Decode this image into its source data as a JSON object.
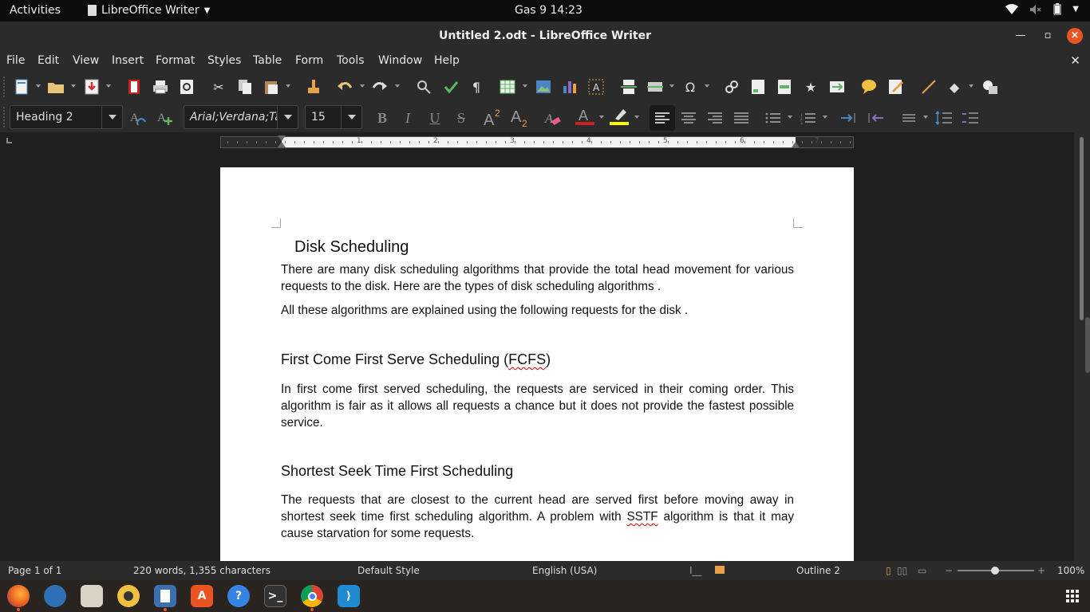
{
  "topbar": {
    "activities": "Activities",
    "app_name": "LibreOffice Writer",
    "clock": "Gas 9  14:23"
  },
  "window": {
    "title": "Untitled 2.odt - LibreOffice Writer"
  },
  "menubar": {
    "items": [
      "File",
      "Edit",
      "View",
      "Insert",
      "Format",
      "Styles",
      "Table",
      "Form",
      "Tools",
      "Window",
      "Help"
    ]
  },
  "formatting": {
    "paragraph_style": "Heading 2",
    "font_name": "Arial;Verdana;Ta",
    "font_size": "15"
  },
  "ruler": {
    "numbers": [
      "1",
      "2",
      "3",
      "4",
      "5",
      "6",
      "7"
    ]
  },
  "document": {
    "title_heading": "Disk Scheduling",
    "intro_p1": "There are many disk scheduling algorithms that provide the total head movement for various requests to the disk. Here are the types of disk scheduling algorithms .",
    "intro_p2": "All these algorithms are explained using the following requests for the disk .",
    "fcfs_heading_pre": "First Come First Serve Scheduling (",
    "fcfs_heading_abbr": "FCFS",
    "fcfs_heading_post": ")",
    "fcfs_p": "In first come first served scheduling, the requests are serviced in their coming order. This algorithm is fair as it allows all requests a chance but it does not provide the fastest possible service.",
    "sstf_heading": "Shortest Seek Time First Scheduling",
    "sstf_p_pre": "The requests that are closest to the current head are served first before moving away in shortest seek time first scheduling algorithm. A problem with ",
    "sstf_p_abbr": "SSTF",
    "sstf_p_post": " algorithm is that it may cause starvation for some requests."
  },
  "statusbar": {
    "page": "Page 1 of 1",
    "words": "220 words, 1,355 characters",
    "page_style": "Default Style",
    "language": "English (USA)",
    "outline": "Outline 2",
    "zoom": "100%"
  },
  "dock": {
    "apps": [
      "firefox-icon",
      "thunderbird-icon",
      "files-icon",
      "rhythmbox-icon",
      "writer-icon",
      "software-icon",
      "help-icon",
      "terminal-icon",
      "chrome-icon",
      "vscode-icon"
    ]
  },
  "colors": {
    "accent": "#e95420",
    "font_color": "#c9211e",
    "highlight": "#ffff00"
  }
}
